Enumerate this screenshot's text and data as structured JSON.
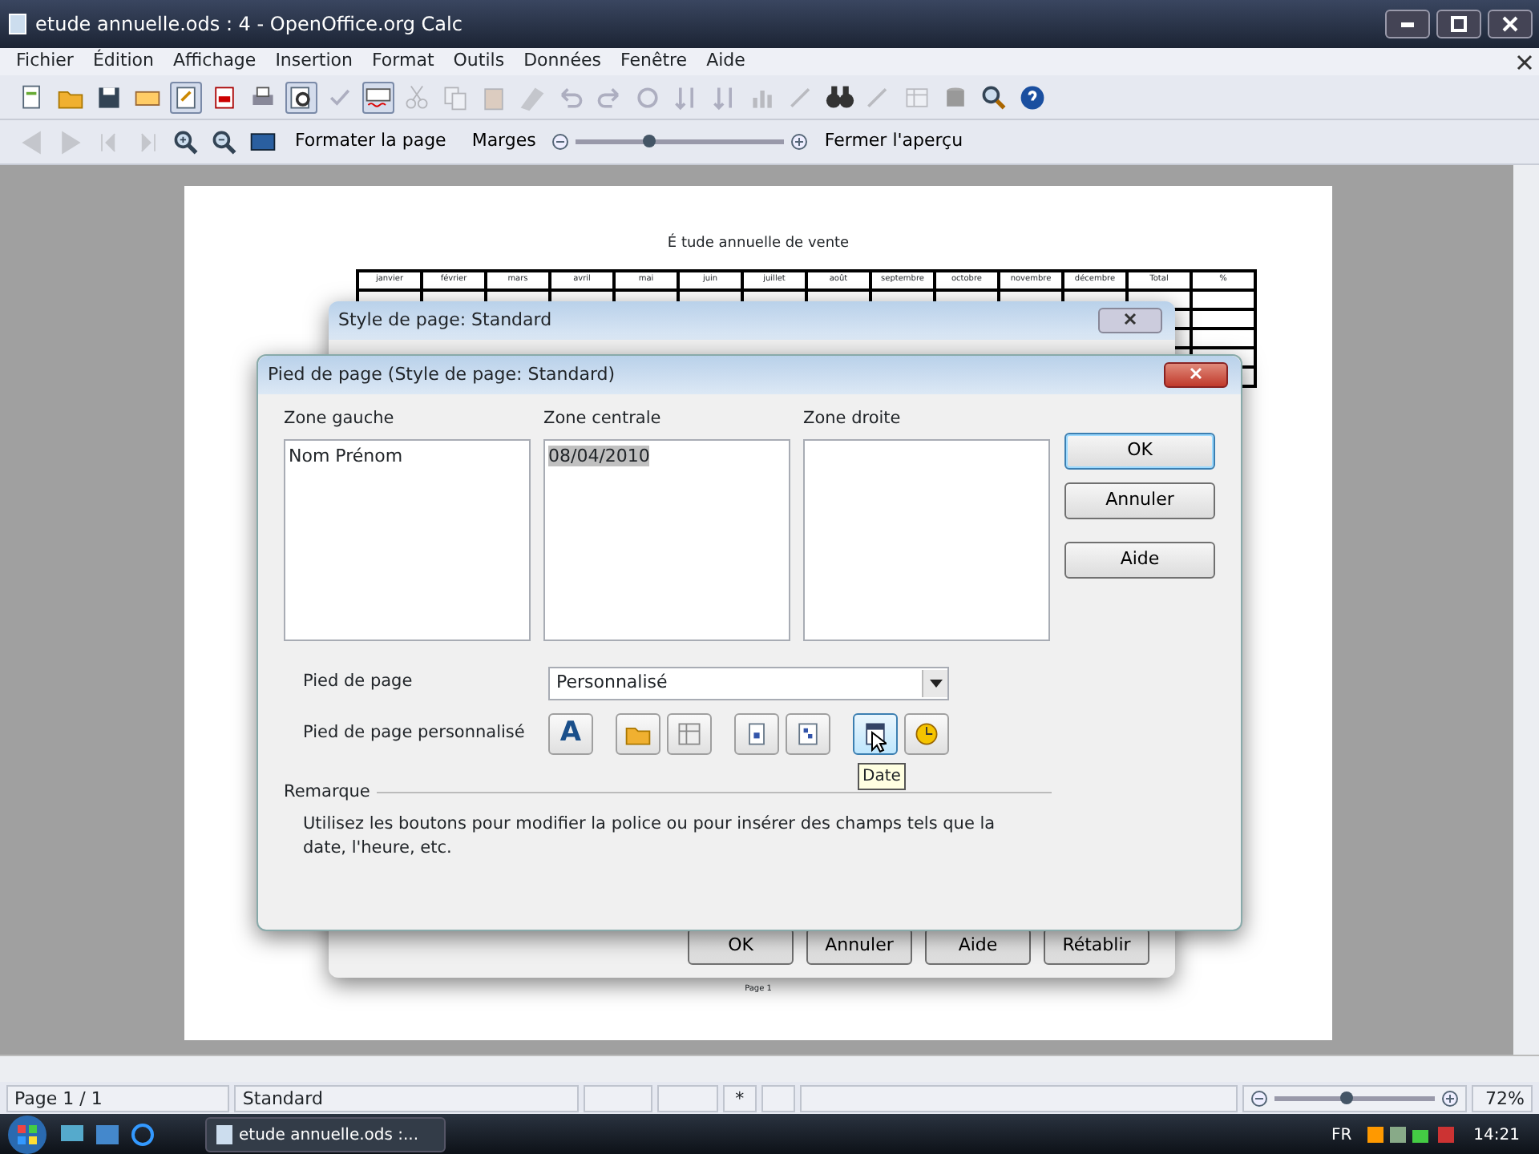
{
  "window": {
    "title": "etude annuelle.ods : 4 - OpenOffice.org Calc"
  },
  "menu": [
    "Fichier",
    "Édition",
    "Affichage",
    "Insertion",
    "Format",
    "Outils",
    "Données",
    "Fenêtre",
    "Aide"
  ],
  "toolbar": [
    {
      "kind": "new",
      "disabled": false
    },
    {
      "kind": "open",
      "disabled": false
    },
    {
      "kind": "save",
      "disabled": false
    },
    {
      "kind": "mail",
      "disabled": false
    },
    {
      "kind": "edit",
      "disabled": false,
      "selected": true
    },
    {
      "kind": "pdf",
      "disabled": false
    },
    {
      "kind": "print",
      "disabled": false
    },
    {
      "kind": "preview",
      "disabled": false,
      "selected": true
    },
    {
      "kind": "spell",
      "disabled": true
    },
    {
      "kind": "autospell",
      "disabled": false,
      "selected": true
    },
    {
      "kind": "cut",
      "disabled": true
    },
    {
      "kind": "copy",
      "disabled": true
    },
    {
      "kind": "paste",
      "disabled": true
    },
    {
      "kind": "brush",
      "disabled": true
    },
    {
      "kind": "undo",
      "disabled": true
    },
    {
      "kind": "redo",
      "disabled": true
    },
    {
      "kind": "link",
      "disabled": true
    },
    {
      "kind": "sort",
      "disabled": true
    },
    {
      "kind": "sort",
      "disabled": true
    },
    {
      "kind": "chart",
      "disabled": true
    },
    {
      "kind": "draw",
      "disabled": true
    },
    {
      "kind": "find",
      "disabled": false
    },
    {
      "kind": "draw",
      "disabled": true
    },
    {
      "kind": "table",
      "disabled": true
    },
    {
      "kind": "db",
      "disabled": false
    },
    {
      "kind": "zoom",
      "disabled": false
    },
    {
      "kind": "help",
      "disabled": false
    }
  ],
  "preview_toolbar": {
    "icons": [
      {
        "kind": "prev",
        "disabled": true
      },
      {
        "kind": "next",
        "disabled": true
      },
      {
        "kind": "first",
        "disabled": true
      },
      {
        "kind": "last",
        "disabled": true
      },
      {
        "kind": "zoomin",
        "disabled": false
      },
      {
        "kind": "zoomout",
        "disabled": false
      },
      {
        "kind": "screen",
        "disabled": false
      }
    ],
    "format_button": "Formater la page",
    "margins_button": "Marges",
    "zoom": {
      "level": 0.35
    },
    "close_button": "Fermer l'aperçu"
  },
  "page": {
    "title": "É tude annuelle de vente",
    "columns": [
      "janvier",
      "février",
      "mars",
      "avril",
      "mai",
      "juin",
      "juillet",
      "août",
      "septembre",
      "octobre",
      "novembre",
      "décembre",
      "Total",
      "%"
    ],
    "footer": "Page 1"
  },
  "back_dialog": {
    "title": "Style de page: Standard",
    "buttons": [
      "OK",
      "Annuler",
      "Aide",
      "Rétablir"
    ]
  },
  "dialog": {
    "title": "Pied de page (Style de page: Standard)",
    "zones": [
      {
        "label": "Zone gauche",
        "text": "Nom Prénom",
        "highlighted": false
      },
      {
        "label": "Zone centrale",
        "text": "08/04/2010",
        "highlighted": true
      },
      {
        "label": "Zone droite"
      }
    ],
    "buttons": [
      {
        "label": "OK",
        "default": true
      },
      {
        "label": "Annuler",
        "default": false
      },
      {
        "label": "Aide",
        "default": false
      }
    ],
    "footer_label": "Pied de page",
    "footer_select": "Personnalisé",
    "custom_label": "Pied de page personnalisé",
    "tools": [
      {
        "kind": "font",
        "selected": false,
        "glyph": "A"
      },
      {
        "kind": "title",
        "selected": false
      },
      {
        "kind": "sheet",
        "selected": false
      },
      {
        "kind": "page",
        "selected": false
      },
      {
        "kind": "pages",
        "selected": false
      },
      {
        "kind": "date",
        "selected": true
      },
      {
        "kind": "time",
        "selected": false
      }
    ],
    "tooltip": "Date",
    "note_title": "Remarque",
    "note": "Utilisez les boutons pour modifier la police ou pour insérer des champs tels que la date, l'heure, etc."
  },
  "status_bar": {
    "page": "Page 1 / 1",
    "style": "Standard",
    "modified": "*",
    "zoom": {
      "level": 0.45
    },
    "zoom_text": "72%"
  },
  "taskbar": {
    "task": "etude annuelle.ods :...",
    "lang": "FR",
    "time": "14:21"
  }
}
